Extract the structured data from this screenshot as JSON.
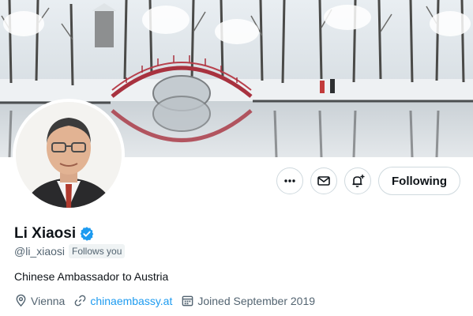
{
  "profile": {
    "name": "Li Xiaosi",
    "handle": "@li_xiaosi",
    "follows_you": "Follows you",
    "bio": "Chinese Ambassador to Austria",
    "location": "Vienna",
    "website": "chinaembassy.at",
    "joined": "Joined September 2019",
    "verified": true
  },
  "actions": {
    "following_label": "Following",
    "more_icon": "more-icon",
    "message_icon": "envelope-icon",
    "notify_icon": "bell-plus-icon"
  },
  "colors": {
    "link": "#1d9bf0",
    "verified": "#1d9bf0",
    "secondary_text": "#536471",
    "border": "#cfd9de"
  }
}
